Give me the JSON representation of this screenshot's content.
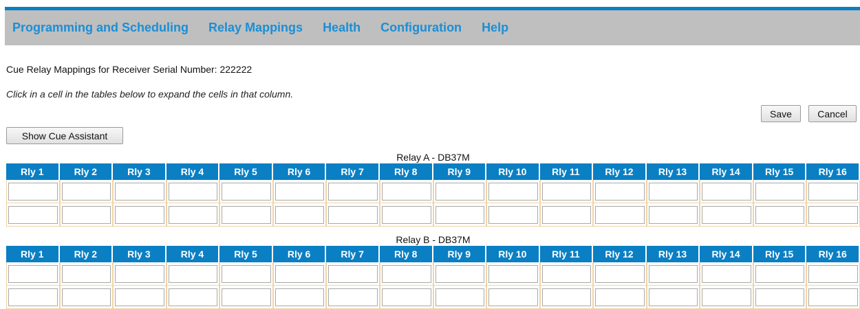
{
  "nav": {
    "items": [
      "Programming and Scheduling",
      "Relay Mappings",
      "Health",
      "Configuration",
      "Help"
    ]
  },
  "page": {
    "serial_label": "Cue Relay Mappings for Receiver Serial Number: 222222",
    "hint": "Click in a cell in the tables below to expand the cells in that column."
  },
  "buttons": {
    "save": "Save",
    "cancel": "Cancel",
    "show_cue_assistant": "Show Cue Assistant"
  },
  "relay_tables": [
    {
      "caption": "Relay A - DB37M",
      "columns": [
        "Rly 1",
        "Rly 2",
        "Rly 3",
        "Rly 4",
        "Rly 5",
        "Rly 6",
        "Rly 7",
        "Rly 8",
        "Rly 9",
        "Rly 10",
        "Rly 11",
        "Rly 12",
        "Rly 13",
        "Rly 14",
        "Rly 15",
        "Rly 16"
      ],
      "rows": 2
    },
    {
      "caption": "Relay B - DB37M",
      "columns": [
        "Rly 1",
        "Rly 2",
        "Rly 3",
        "Rly 4",
        "Rly 5",
        "Rly 6",
        "Rly 7",
        "Rly 8",
        "Rly 9",
        "Rly 10",
        "Rly 11",
        "Rly 12",
        "Rly 13",
        "Rly 14",
        "Rly 15",
        "Rly 16"
      ],
      "rows": 2
    }
  ]
}
